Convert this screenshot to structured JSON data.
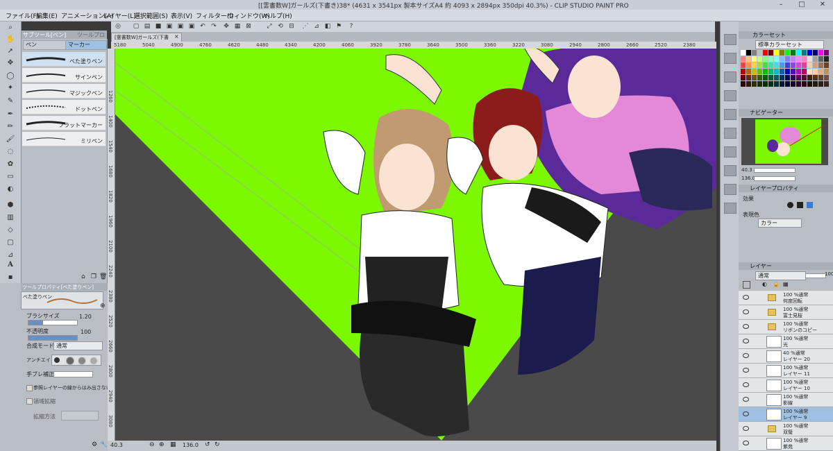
{
  "window": {
    "title": "[[霊書数W]ガールズ(下書き)38* (4631 x 3541px 製本サイズA4 約 4093 x 2894px 350dpi 40.3%)  - CLIP STUDIO PAINT PRO",
    "minimize": "–",
    "maximize": "□",
    "close": "✕"
  },
  "menu": [
    "ファイル(F)",
    "編集(E)",
    "アニメーション(A)",
    "レイヤー(L)",
    "選択範囲(S)",
    "表示(V)",
    "フィルター(I)",
    "ウィンドウ(W)",
    "ヘルプ(H)"
  ],
  "document_tab": "[霊書数W]ガールズ(下書き)38*",
  "subtool": {
    "tab1": "サブツール[ペン]",
    "tab2": "ツールプロパティ",
    "group_pen": "ペン",
    "group_marker": "マーカー",
    "brushes": [
      "べた塗りペン",
      "サインペン",
      "マジックペン",
      "ドットペン",
      "フラットマーカー",
      "ミリペン"
    ]
  },
  "toolprop": {
    "header": "ツールプロパティ[べた塗りペン]",
    "brush_name": "べた塗りペン",
    "brush_size_label": "ブラシサイズ",
    "brush_size_value": "1.20",
    "opacity_label": "不透明度",
    "opacity_value": "100",
    "blend_label": "合成モード",
    "blend_value": "通常",
    "aa_label": "アンチエイリアス",
    "stab_label": "手ブレ補正",
    "ref_label": "参照レイヤーの線からはみ出さない",
    "expand_label": "領域拡縮",
    "expand_method_label": "拡縮方法"
  },
  "ruler": {
    "top": [
      "5180",
      "5040",
      "4900",
      "4760",
      "4620",
      "4480",
      "4340",
      "4200",
      "4060",
      "3920",
      "3780",
      "3640",
      "3500",
      "3360",
      "3220",
      "3080",
      "2940",
      "2800",
      "2660",
      "2520",
      "2380"
    ],
    "left": [
      "1260",
      "1400",
      "1540",
      "1680",
      "1820",
      "1960",
      "2100",
      "2240",
      "2380",
      "2520",
      "2660",
      "2800",
      "2940",
      "3080"
    ]
  },
  "status": {
    "zoom": "40.3",
    "rotation": "136.0"
  },
  "color_set": {
    "header": "カラーセット",
    "set_name": "標準カラーセット",
    "swatches": [
      "#ffffff",
      "#000000",
      "#808080",
      "#c0c0c0",
      "#ff0000",
      "#800000",
      "#ffff00",
      "#808000",
      "#00ff00",
      "#008000",
      "#00ffff",
      "#008080",
      "#0000ff",
      "#000080",
      "#ff00ff",
      "#800080",
      "#ff8080",
      "#ffc080",
      "#ffff80",
      "#c0ff80",
      "#80ff80",
      "#80ffc0",
      "#80ffff",
      "#80c0ff",
      "#8080ff",
      "#c080ff",
      "#ff80ff",
      "#ff80c0",
      "#e0e0e0",
      "#a0a0a0",
      "#606060",
      "#202020",
      "#ff4040",
      "#ff9040",
      "#ffd040",
      "#a0e040",
      "#40e040",
      "#40e0a0",
      "#40e0e0",
      "#40a0e0",
      "#4040e0",
      "#a040e0",
      "#e040e0",
      "#e040a0",
      "#f0d0b0",
      "#d0a080",
      "#a07050",
      "#704020",
      "#c00000",
      "#c06000",
      "#c0c000",
      "#60c000",
      "#00c000",
      "#00c060",
      "#00c0c0",
      "#0060c0",
      "#0000c0",
      "#6000c0",
      "#c000c0",
      "#c00060",
      "#ffe0c0",
      "#ffd0a0",
      "#e0b080",
      "#c09060",
      "#600000",
      "#603000",
      "#606000",
      "#306000",
      "#006000",
      "#006030",
      "#006060",
      "#003060",
      "#000060",
      "#300060",
      "#600060",
      "#600030",
      "#402010",
      "#503020",
      "#604030",
      "#705040",
      "#300000",
      "#301800",
      "#303000",
      "#183000",
      "#003000",
      "#003018",
      "#003030",
      "#001830",
      "#000030",
      "#180030",
      "#300030",
      "#300018",
      "#201008",
      "#281810",
      "#302018",
      "#382820"
    ]
  },
  "navigator": {
    "header": "ナビゲーター",
    "zoom": "40.3",
    "rotation": "136.0"
  },
  "layer_property": {
    "header": "レイヤープロパティ",
    "effect_label": "効果",
    "color_label": "表現色",
    "color_value": "カラー"
  },
  "layers": {
    "header": "レイヤー",
    "blend": "通常",
    "opacity": "100",
    "items": [
      {
        "l1": "100 %通常",
        "l2": "何度回転",
        "folder": true
      },
      {
        "l1": "100 %通常",
        "l2": "富士見桜",
        "folder": true
      },
      {
        "l1": "100 %通常",
        "l2": "リボンのコピー",
        "folder": true
      },
      {
        "l1": "100 %通常",
        "l2": "光",
        "folder": false
      },
      {
        "l1": "40 %通常",
        "l2": "レイヤー 20",
        "folder": false
      },
      {
        "l1": "100 %通常",
        "l2": "レイヤー 11",
        "folder": false
      },
      {
        "l1": "100 %通常",
        "l2": "レイヤー 10",
        "folder": false
      },
      {
        "l1": "100 %通常",
        "l2": "影線",
        "folder": false
      },
      {
        "l1": "100 %通常",
        "l2": "レイヤー 9",
        "folder": false,
        "selected": true
      },
      {
        "l1": "100 %通常",
        "l2": "双璧",
        "folder": true
      },
      {
        "l1": "100 %通常",
        "l2": "紫苑",
        "folder": false
      }
    ]
  },
  "colors": {
    "canvas_bg": "#7cf800",
    "main_color": "#b87333",
    "sub_color": "#1a1060",
    "selected_layer": "#9fc0e0"
  }
}
